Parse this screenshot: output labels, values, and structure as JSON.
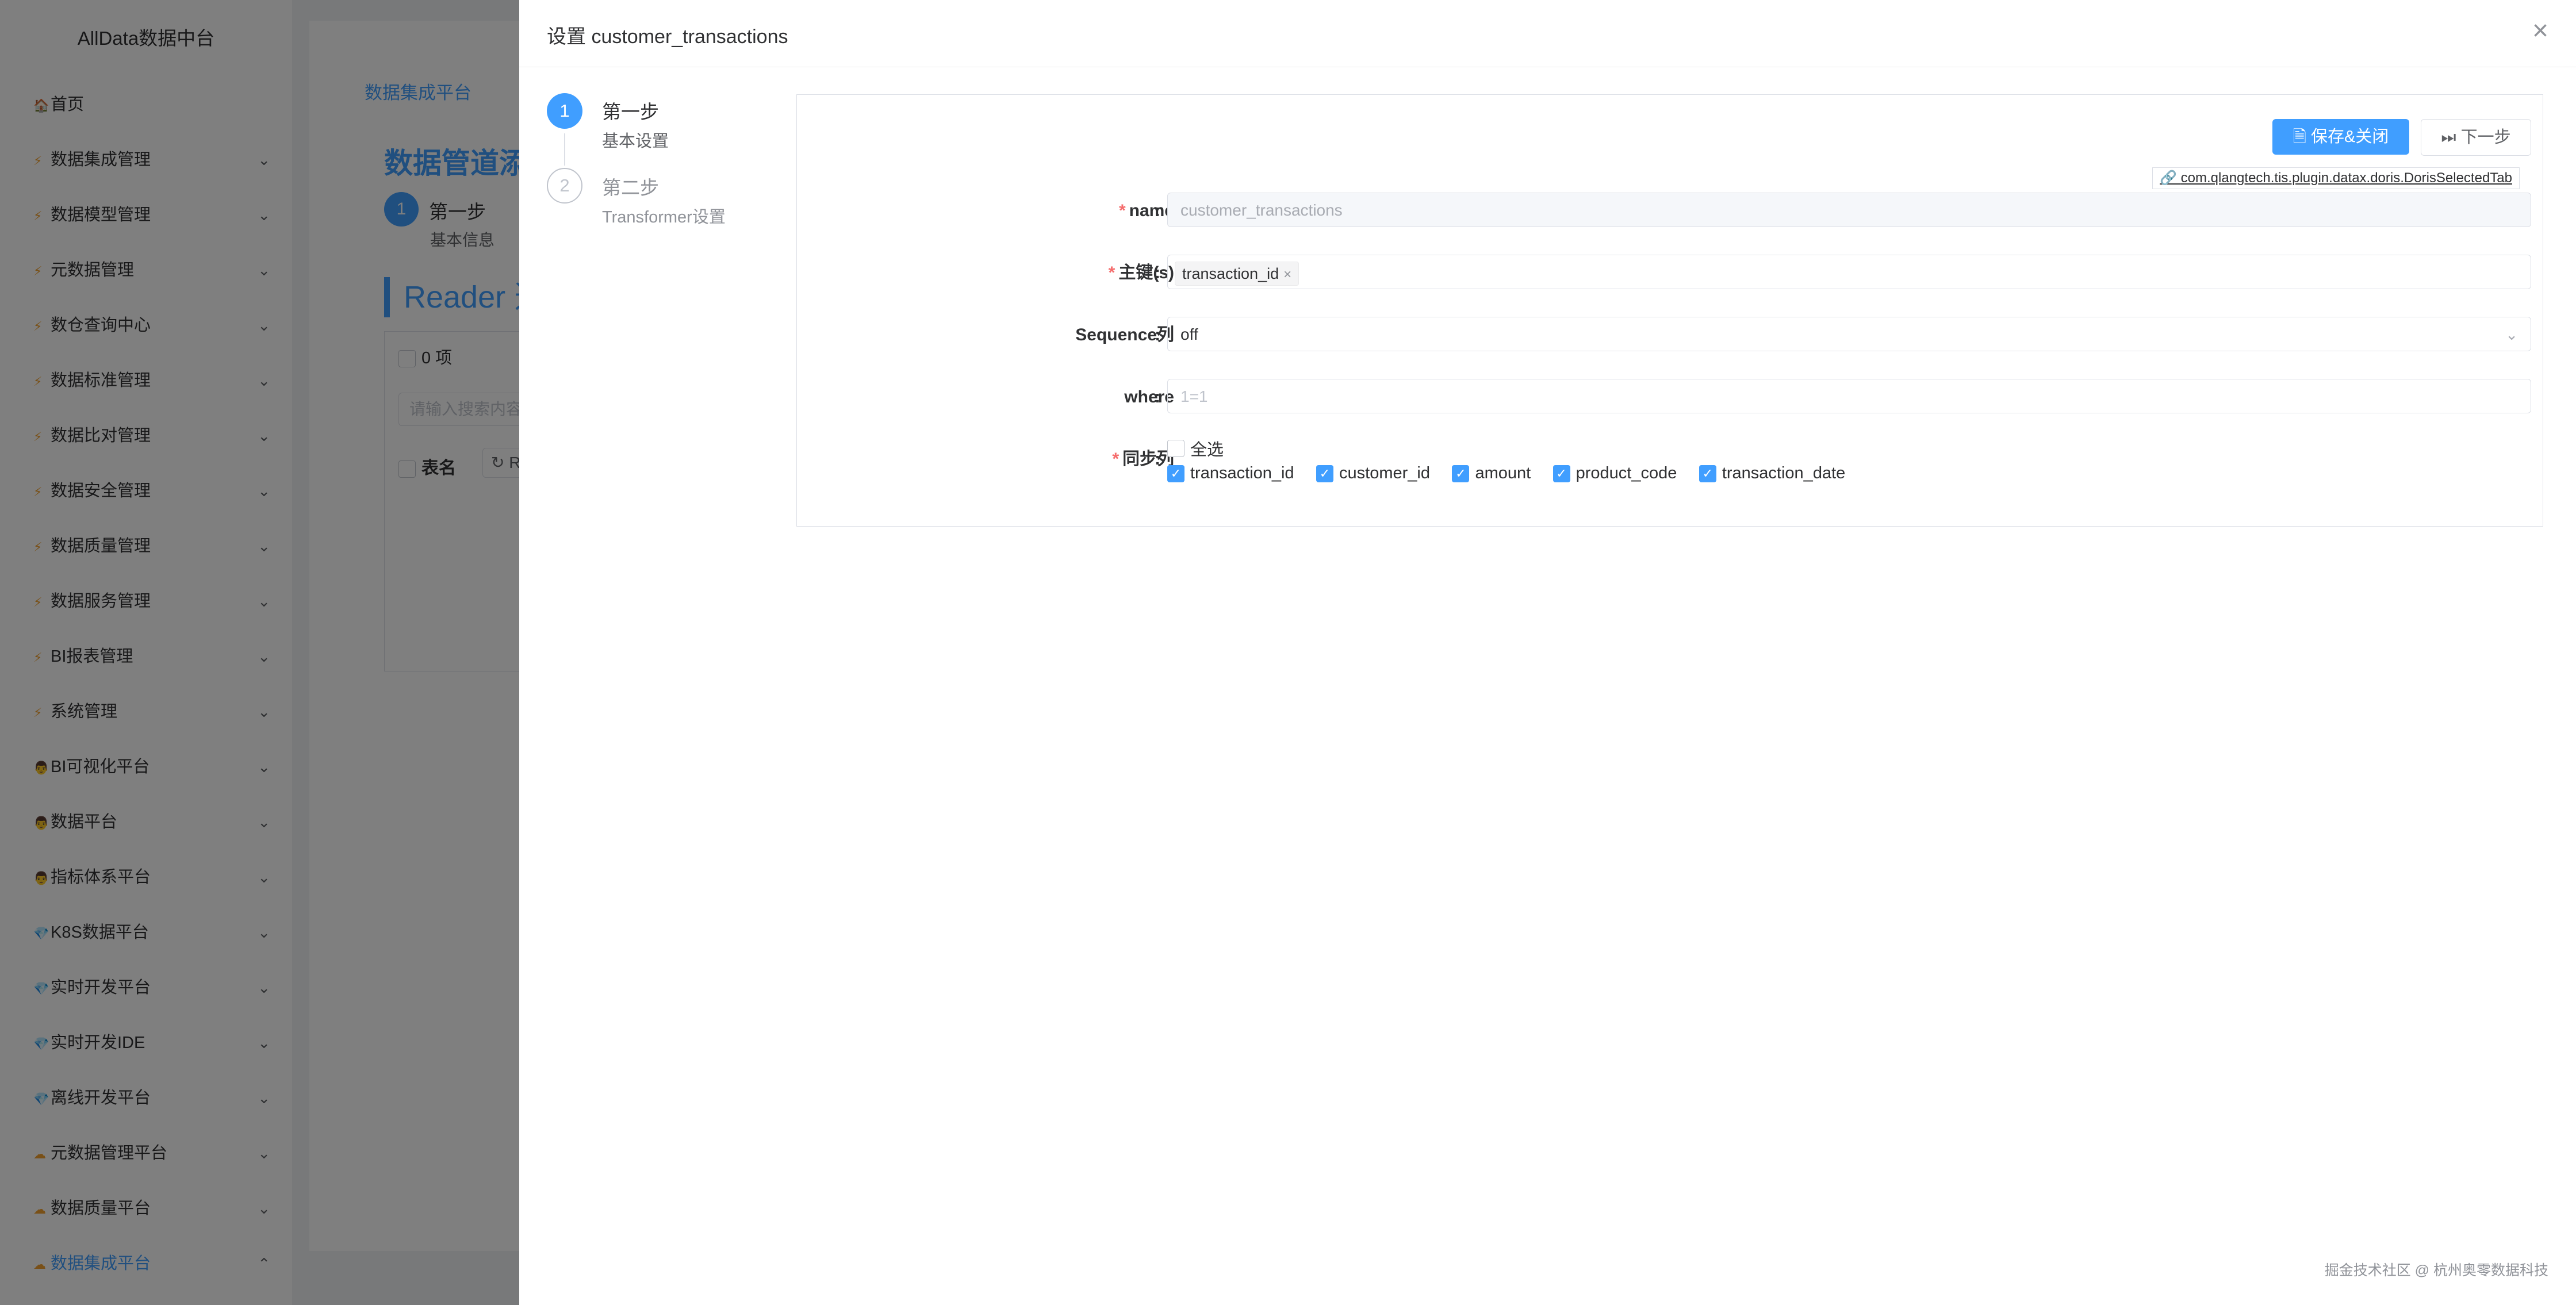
{
  "app": {
    "title": "AllData数据中台"
  },
  "sidebar": {
    "items": [
      {
        "label": "首页",
        "icon": "home-icon",
        "glyph": "🏠",
        "arrow": ""
      },
      {
        "label": "数据集成管理",
        "icon": "bolt-icon",
        "glyph": "⚡",
        "arrow": "⌄"
      },
      {
        "label": "数据模型管理",
        "icon": "bolt-icon",
        "glyph": "⚡",
        "arrow": "⌄"
      },
      {
        "label": "元数据管理",
        "icon": "bolt-icon",
        "glyph": "⚡",
        "arrow": "⌄"
      },
      {
        "label": "数仓查询中心",
        "icon": "bolt-icon",
        "glyph": "⚡",
        "arrow": "⌄"
      },
      {
        "label": "数据标准管理",
        "icon": "bolt-icon",
        "glyph": "⚡",
        "arrow": "⌄"
      },
      {
        "label": "数据比对管理",
        "icon": "bolt-icon",
        "glyph": "⚡",
        "arrow": "⌄"
      },
      {
        "label": "数据安全管理",
        "icon": "bolt-icon",
        "glyph": "⚡",
        "arrow": "⌄"
      },
      {
        "label": "数据质量管理",
        "icon": "bolt-icon",
        "glyph": "⚡",
        "arrow": "⌄"
      },
      {
        "label": "数据服务管理",
        "icon": "bolt-icon",
        "glyph": "⚡",
        "arrow": "⌄"
      },
      {
        "label": "BI报表管理",
        "icon": "bolt-icon",
        "glyph": "⚡",
        "arrow": "⌄"
      },
      {
        "label": "系统管理",
        "icon": "bolt-icon",
        "glyph": "⚡",
        "arrow": "⌄"
      },
      {
        "label": "BI可视化平台",
        "icon": "person-icon",
        "glyph": "👨",
        "arrow": "⌄"
      },
      {
        "label": "数据平台",
        "icon": "person-icon",
        "glyph": "👨",
        "arrow": "⌄"
      },
      {
        "label": "指标体系平台",
        "icon": "person-icon",
        "glyph": "👨",
        "arrow": "⌄"
      },
      {
        "label": "K8S数据平台",
        "icon": "gem-icon",
        "glyph": "💎",
        "arrow": "⌄"
      },
      {
        "label": "实时开发平台",
        "icon": "gem-icon",
        "glyph": "💎",
        "arrow": "⌄"
      },
      {
        "label": "实时开发IDE",
        "icon": "gem-icon",
        "glyph": "💎",
        "arrow": "⌄"
      },
      {
        "label": "离线开发平台",
        "icon": "gem-icon",
        "glyph": "💎",
        "arrow": "⌄"
      },
      {
        "label": "元数据管理平台",
        "icon": "cloud-icon",
        "glyph": "☁",
        "arrow": "⌄"
      },
      {
        "label": "数据质量平台",
        "icon": "cloud-icon",
        "glyph": "☁",
        "arrow": "⌄"
      },
      {
        "label": "数据集成平台",
        "icon": "cloud-icon",
        "glyph": "☁",
        "arrow": "⌃"
      }
    ]
  },
  "background": {
    "breadcrumb": "数据集成平台",
    "page_title": "数据管道添加",
    "step_number": "1",
    "step_title": "第一步",
    "step_sub": "基本信息",
    "reader_title": "Reader 选",
    "count_label": "0 项",
    "search_placeholder": "请输入搜索内容",
    "col_table": "表名",
    "refresh_label": "Re"
  },
  "drawer": {
    "title": "设置 customer_transactions",
    "close_glyph": "×"
  },
  "steps": [
    {
      "number": "1",
      "title": "第一步",
      "sub": "基本设置"
    },
    {
      "number": "2",
      "title": "第二步",
      "sub": "Transformer设置"
    }
  ],
  "toolbar": {
    "save_close_label": "保存&关闭",
    "next_label": "下一步",
    "plugin_link": "com.qlangtech.tis.plugin.datax.doris.DorisSelectedTab"
  },
  "form": {
    "name": {
      "label": "name",
      "value": "customer_transactions"
    },
    "primary_keys": {
      "label": "主键(s)",
      "tags": [
        "transaction_id"
      ]
    },
    "sequence": {
      "label": "Sequence列",
      "value": "off"
    },
    "where": {
      "label": "where",
      "placeholder": "1=1"
    },
    "sync_cols": {
      "label": "同步列",
      "select_all_label": "全选",
      "select_all_checked": false,
      "columns": [
        {
          "name": "transaction_id",
          "checked": true
        },
        {
          "name": "customer_id",
          "checked": true
        },
        {
          "name": "amount",
          "checked": true
        },
        {
          "name": "product_code",
          "checked": true
        },
        {
          "name": "transaction_date",
          "checked": true
        }
      ]
    }
  },
  "watermark": "掘金技术社区 @ 杭州奥零数据科技",
  "colors": {
    "accent": "#409eff",
    "required": "#f56c6c"
  }
}
